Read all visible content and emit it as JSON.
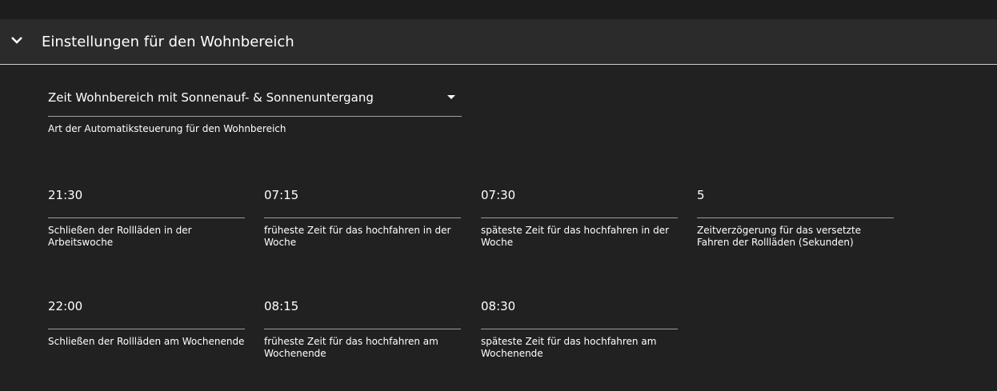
{
  "panel": {
    "title": "Einstellungen für den Wohnbereich"
  },
  "mode_select": {
    "value": "Zeit Wohnbereich mit Sonnenauf- & Sonnenuntergang",
    "helper": "Art der Automatiksteuerung für den Wohnbereich"
  },
  "fields": [
    {
      "value": "21:30",
      "label": "Schließen der Rollläden in der Arbeitswoche"
    },
    {
      "value": "07:15",
      "label": "früheste Zeit für das hochfahren in der Woche"
    },
    {
      "value": "07:30",
      "label": "späteste Zeit für das hochfahren in der Woche"
    },
    {
      "value": "5",
      "label": "Zeitverzögerung für das versetzte Fahren der Rollläden (Sekunden)"
    },
    {
      "value": "22:00",
      "label": "Schließen der Rollläden am Wochenende"
    },
    {
      "value": "08:15",
      "label": "früheste Zeit für das hochfahren am Wochenende"
    },
    {
      "value": "08:30",
      "label": "späteste Zeit für das hochfahren am Wochenende"
    }
  ]
}
